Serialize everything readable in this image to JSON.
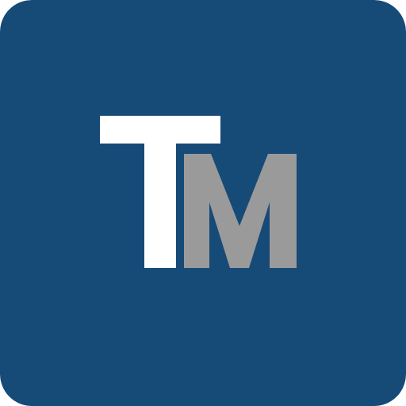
{
  "logo": {
    "letters": "TM",
    "colors": {
      "background": "#164a77",
      "letter_t": "#ffffff",
      "letter_m": "#9a9a9a"
    }
  }
}
